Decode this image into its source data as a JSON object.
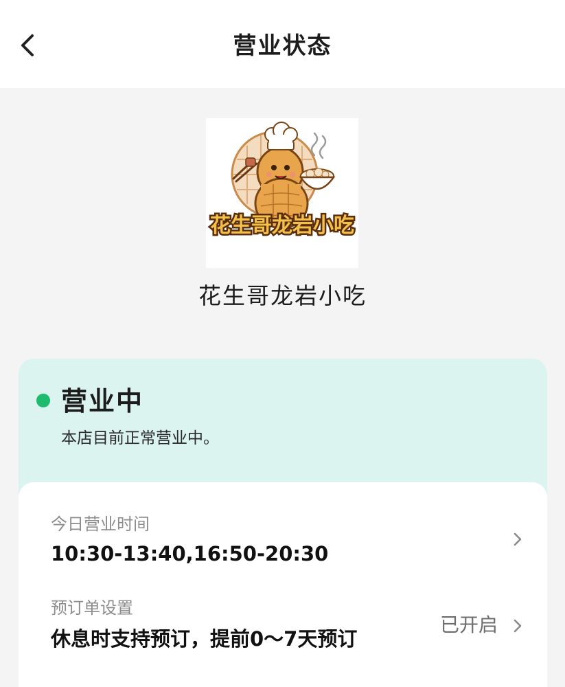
{
  "header": {
    "title": "营业状态"
  },
  "shop": {
    "name": "花生哥龙岩小吃",
    "logo_text": "花生哥龙岩小吃"
  },
  "status": {
    "title": "营业中",
    "description": "本店目前正常营业中。",
    "dot_color": "#1dbb6e"
  },
  "business_hours": {
    "label": "今日营业时间",
    "value": "10:30-13:40,16:50-20:30"
  },
  "reservation": {
    "label": "预订单设置",
    "value": "休息时支持预订，提前0～7天预订",
    "status": "已开启"
  },
  "colors": {
    "status_card_bg": "#dbf4ef",
    "page_bg": "#f4f4f4"
  }
}
